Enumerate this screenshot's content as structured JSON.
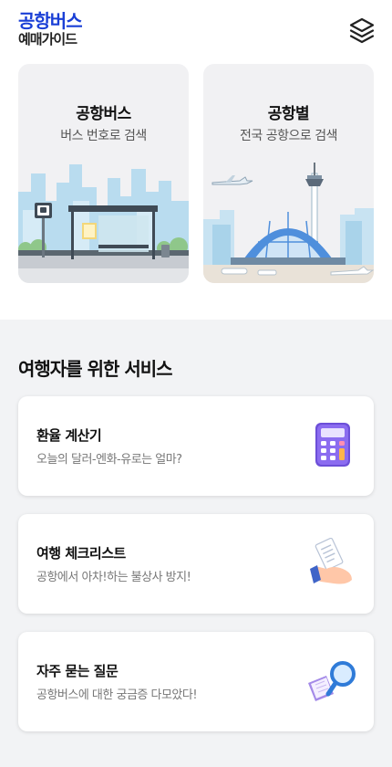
{
  "header": {
    "logo_line1": "공항버스",
    "logo_line2": "예매가이드",
    "menu_icon": "layers-icon"
  },
  "search_cards": [
    {
      "title": "공항버스",
      "subtitle": "버스 번호로 검색",
      "icon": "bus-stop-illustration"
    },
    {
      "title": "공항별",
      "subtitle": "전국 공항으로 검색",
      "icon": "airport-illustration"
    }
  ],
  "services": {
    "section_title": "여행자를 위한 서비스",
    "items": [
      {
        "title": "환율 계산기",
        "description": "오늘의 달러-엔화-유로는 얼마?",
        "icon": "calculator-icon"
      },
      {
        "title": "여행 체크리스트",
        "description": "공항에서 아차!하는 불상사 방지!",
        "icon": "checklist-hand-icon"
      },
      {
        "title": "자주 묻는 질문",
        "description": "공항버스에 대한 궁금증 다모았다!",
        "icon": "faq-magnifier-icon"
      }
    ]
  },
  "colors": {
    "brand": "#1a3fd6",
    "background": "#f2f3f5",
    "card": "#f1f1f3"
  }
}
